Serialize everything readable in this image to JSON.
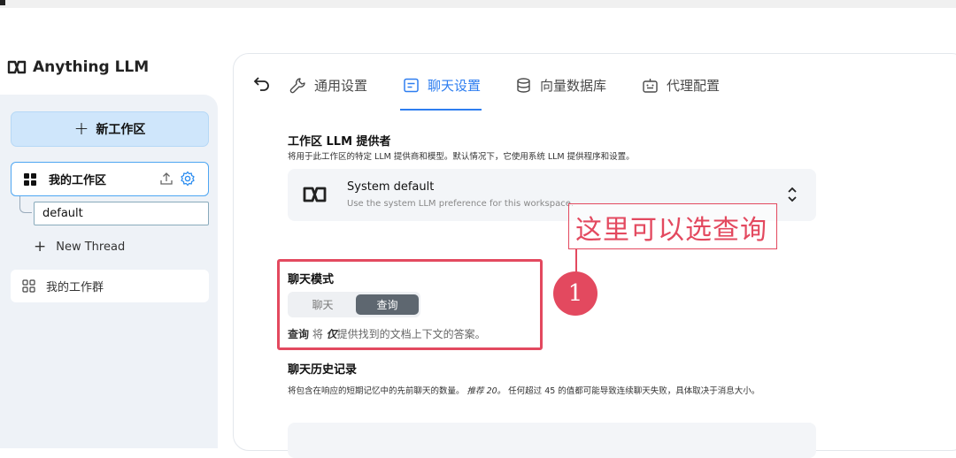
{
  "app": {
    "name": "Anything LLM"
  },
  "sidebar": {
    "new_workspace_label": "新工作区",
    "workspaces": [
      {
        "label": "我的工作区",
        "threads": [
          "default"
        ],
        "new_thread_label": "New Thread"
      },
      {
        "label": "我的工作群"
      }
    ]
  },
  "tabs": [
    {
      "label": "通用设置",
      "icon": "wrench-icon"
    },
    {
      "label": "聊天设置",
      "icon": "chat-icon",
      "active": true
    },
    {
      "label": "向量数据库",
      "icon": "database-icon"
    },
    {
      "label": "代理配置",
      "icon": "robot-icon"
    }
  ],
  "llm_provider": {
    "title": "工作区 LLM 提供者",
    "description": "将用于此工作区的特定 LLM 提供商和模型。默认情况下，它使用系统 LLM 提供程序和设置。",
    "selected_name": "System default",
    "selected_desc": "Use the system LLM preference for this workspace."
  },
  "annotation": {
    "text": "这里可以选查询",
    "step": "1",
    "color": "#e3495f"
  },
  "chat_mode": {
    "title": "聊天模式",
    "options": [
      "聊天",
      "查询"
    ],
    "selected": "查询",
    "desc_prefix": "查询",
    "desc_mid": " 将 ",
    "desc_em": "仅",
    "desc_rest": "提供找到的文档上下文的答案。"
  },
  "chat_history": {
    "title": "聊天历史记录",
    "desc_a": "将包含在响应的短期记忆中的先前聊天的数量。",
    "desc_em": "推荐 20。",
    "desc_b": " 任何超过 45 的值都可能导致连续聊天失败，具体取决于消息大小。"
  },
  "colors": {
    "accent": "#2e7ef0",
    "annotation": "#e3495f",
    "workspace_button": "#cfe6fb"
  }
}
